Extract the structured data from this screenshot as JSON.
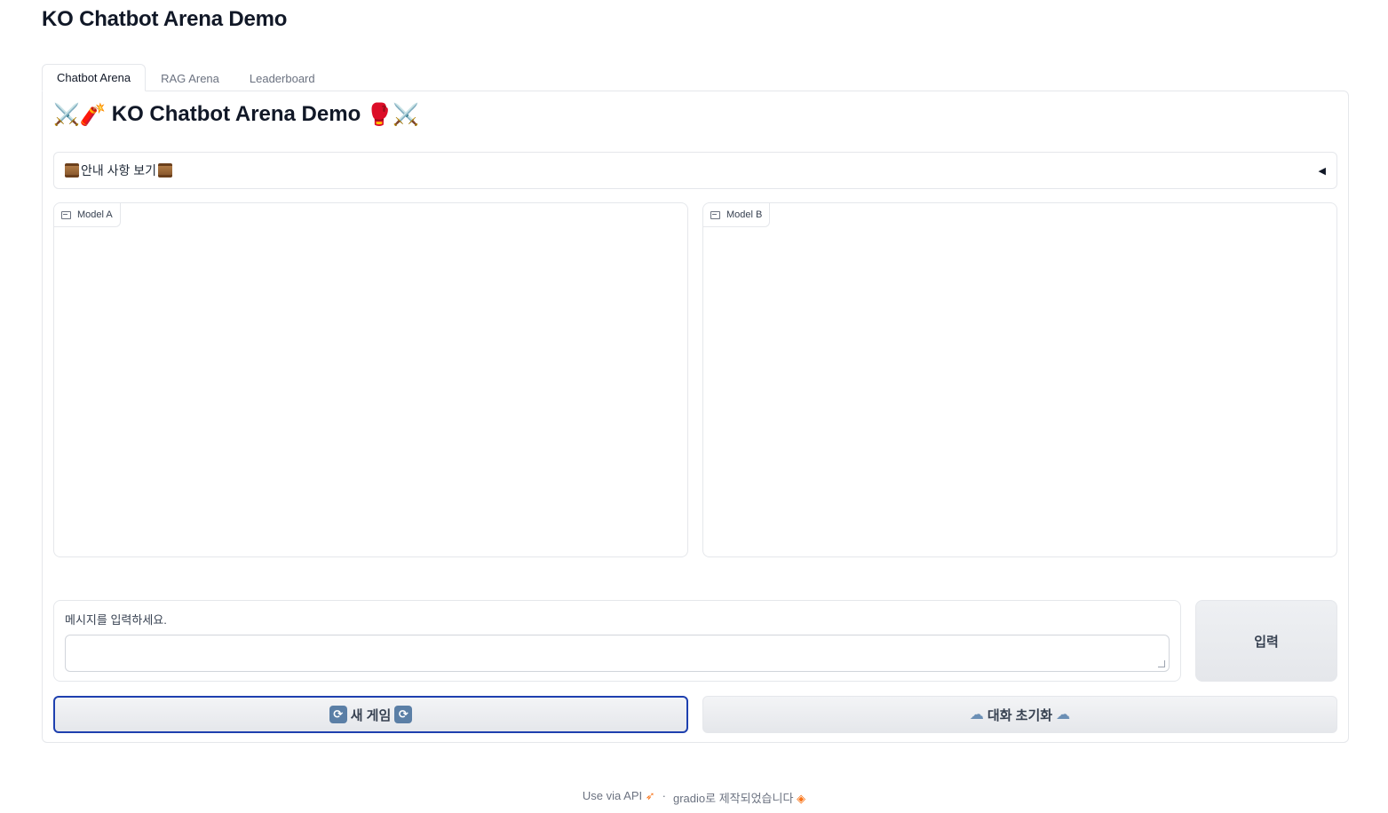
{
  "app": {
    "title": "KO Chatbot Arena Demo"
  },
  "tabs": [
    {
      "label": "Chatbot Arena",
      "active": true
    },
    {
      "label": "RAG Arena",
      "active": false
    },
    {
      "label": "Leaderboard",
      "active": false
    }
  ],
  "arena": {
    "heading": "KO Chatbot Arena Demo",
    "heading_left_emoji": "⚔️🧨",
    "heading_right_emoji": "🥊⚔️",
    "guide_label": "안내 사항 보기",
    "guide_expanded": false
  },
  "chatbots": {
    "a": {
      "label": "Model A",
      "messages": []
    },
    "b": {
      "label": "Model B",
      "messages": []
    }
  },
  "input": {
    "label": "메시지를 입력하세요.",
    "value": "",
    "placeholder": ""
  },
  "buttons": {
    "submit": "입력",
    "new_game": "새 게임",
    "reset": "대화 초기화"
  },
  "footer": {
    "api_link": "Use via API",
    "separator": "·",
    "built_with": "gradio로 제작되었습니다"
  },
  "colors": {
    "accent_border": "#1e40af",
    "panel_border": "#e5e7eb",
    "button_bg": "#e5e7eb"
  },
  "icons": {
    "tab_panel": "chat-icon",
    "guide": "scroll-icon",
    "new_game": "refresh-icon",
    "reset": "rain-cloud-icon",
    "api": "rocket-icon",
    "gradio": "gradio-logo-icon"
  }
}
